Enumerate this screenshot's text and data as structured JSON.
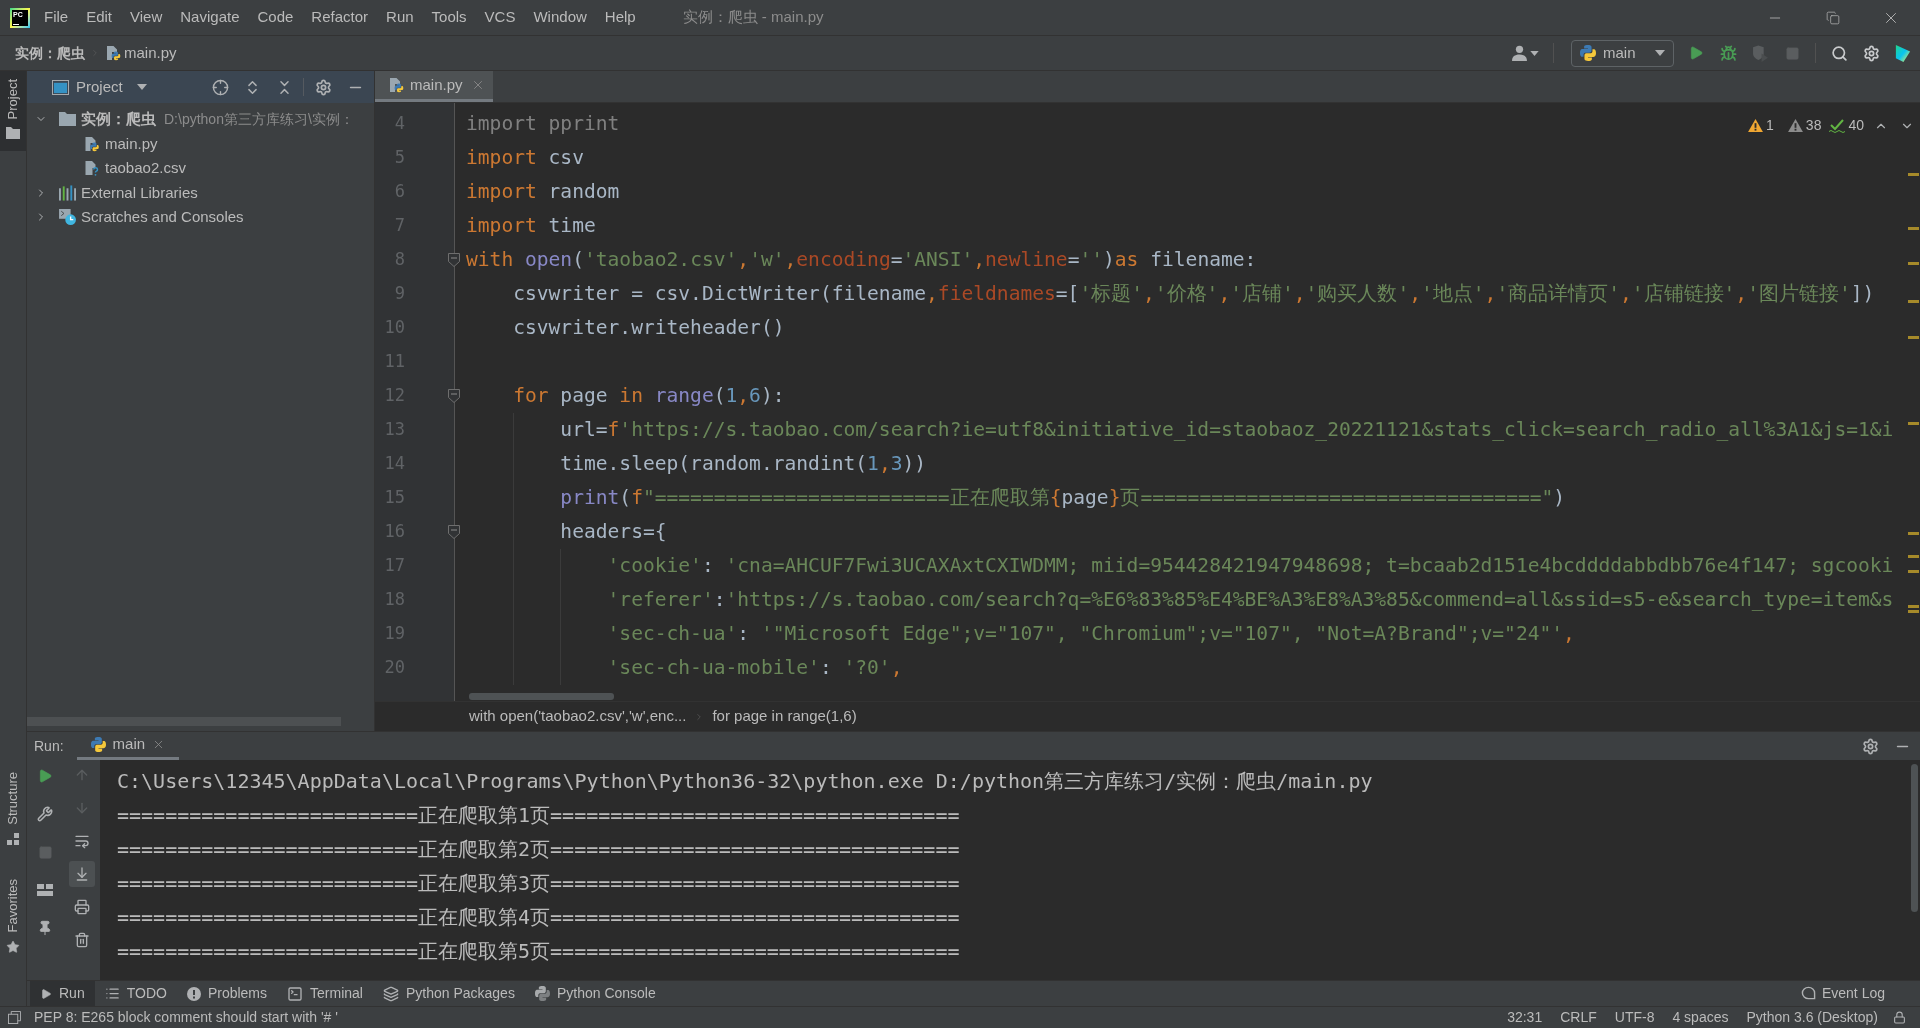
{
  "menu_bar": {
    "logo": "PC",
    "items": [
      "File",
      "Edit",
      "View",
      "Navigate",
      "Code",
      "Refactor",
      "Run",
      "Tools",
      "VCS",
      "Window",
      "Help"
    ],
    "window_title": "实例：爬虫 - main.py"
  },
  "nav_bar": {
    "project": "实例：爬虫",
    "file": "main.py",
    "run_config": "main",
    "actions": [
      {
        "kind": "run",
        "disabled": false
      },
      {
        "kind": "debug",
        "disabled": false
      },
      {
        "kind": "coverage",
        "disabled": true
      },
      {
        "kind": "stop",
        "disabled": true
      }
    ]
  },
  "left_stripe": {
    "top": [
      {
        "kind": "project",
        "label": "Project",
        "selected": true
      }
    ],
    "bottom": [
      {
        "kind": "structure",
        "label": "Structure",
        "selected": false
      },
      {
        "kind": "favorites",
        "label": "Favorites",
        "selected": false
      }
    ]
  },
  "project_panel": {
    "title": "Project",
    "tree": [
      {
        "kind": "folder",
        "label": "实例：爬虫",
        "path": "D:\\python第三方库练习\\实例：",
        "expanded": true,
        "children": [
          {
            "kind": "python",
            "label": "main.py"
          },
          {
            "kind": "unknown",
            "label": "taobao2.csv"
          }
        ]
      },
      {
        "kind": "libraries",
        "label": "External Libraries",
        "expanded": false
      },
      {
        "kind": "scratches",
        "label": "Scratches and Consoles",
        "expanded": false
      }
    ]
  },
  "editor": {
    "tabs": [
      {
        "label": "main.py",
        "selected": true
      }
    ],
    "inspections": {
      "warnings": "1",
      "weak_warnings": "38",
      "typos": "40"
    },
    "lines": [
      {
        "number": "4",
        "tokens": [
          {
            "kind": "unused",
            "text": "import pprint"
          }
        ]
      },
      {
        "number": "5",
        "tokens": [
          {
            "kind": "keyword",
            "text": "import"
          },
          {
            "kind": "plain",
            "text": " csv"
          }
        ]
      },
      {
        "number": "6",
        "tokens": [
          {
            "kind": "keyword",
            "text": "import"
          },
          {
            "kind": "plain",
            "text": " random"
          }
        ]
      },
      {
        "number": "7",
        "tokens": [
          {
            "kind": "keyword",
            "text": "import"
          },
          {
            "kind": "plain",
            "text": " time"
          }
        ]
      },
      {
        "number": "8",
        "tokens": [
          {
            "kind": "keyword",
            "text": "with"
          },
          {
            "kind": "builtin",
            "text": " open"
          },
          {
            "kind": "plain",
            "text": "("
          },
          {
            "kind": "string",
            "text": "'taobao2.csv'"
          },
          {
            "kind": "comma",
            "text": ","
          },
          {
            "kind": "string",
            "text": "'w'"
          },
          {
            "kind": "comma",
            "text": ","
          },
          {
            "kind": "param",
            "text": "encoding"
          },
          {
            "kind": "plain",
            "text": "="
          },
          {
            "kind": "string",
            "text": "'ANSI'"
          },
          {
            "kind": "comma",
            "text": ","
          },
          {
            "kind": "param",
            "text": "newline"
          },
          {
            "kind": "plain",
            "text": "="
          },
          {
            "kind": "string",
            "text": "''"
          },
          {
            "kind": "plain",
            "text": ")"
          },
          {
            "kind": "keyword",
            "text": "as"
          },
          {
            "kind": "plain",
            "text": " filename:"
          }
        ],
        "children": [
          {
            "number": "9",
            "tokens": [
              {
                "kind": "plain",
                "text": "csvwriter = csv.DictWriter(filename"
              },
              {
                "kind": "comma",
                "text": ","
              },
              {
                "kind": "param",
                "text": "fieldnames"
              },
              {
                "kind": "plain",
                "text": "=["
              },
              {
                "kind": "string",
                "text": "'标题'"
              },
              {
                "kind": "comma",
                "text": ","
              },
              {
                "kind": "string",
                "text": "'价格'"
              },
              {
                "kind": "comma",
                "text": ","
              },
              {
                "kind": "string",
                "text": "'店铺'"
              },
              {
                "kind": "comma",
                "text": ","
              },
              {
                "kind": "string",
                "text": "'购买人数'"
              },
              {
                "kind": "comma",
                "text": ","
              },
              {
                "kind": "string",
                "text": "'地点'"
              },
              {
                "kind": "comma",
                "text": ","
              },
              {
                "kind": "string",
                "text": "'商品详情页'"
              },
              {
                "kind": "comma",
                "text": ","
              },
              {
                "kind": "string",
                "text": "'店铺链接'"
              },
              {
                "kind": "comma",
                "text": ","
              },
              {
                "kind": "string",
                "text": "'图片链接'"
              },
              {
                "kind": "plain",
                "text": "])"
              }
            ]
          },
          {
            "number": "10",
            "tokens": [
              {
                "kind": "plain",
                "text": "csvwriter.writeheader()"
              }
            ]
          },
          {
            "number": "11"
          },
          {
            "number": "12",
            "tokens": [
              {
                "kind": "keyword",
                "text": "for"
              },
              {
                "kind": "plain",
                "text": " page "
              },
              {
                "kind": "keyword",
                "text": "in"
              },
              {
                "kind": "builtin",
                "text": " range"
              },
              {
                "kind": "plain",
                "text": "("
              },
              {
                "kind": "number",
                "text": "1"
              },
              {
                "kind": "comma",
                "text": ","
              },
              {
                "kind": "number",
                "text": "6"
              },
              {
                "kind": "plain",
                "text": "):"
              }
            ],
            "children": [
              {
                "number": "13",
                "tokens": [
                  {
                    "kind": "plain",
                    "text": "url="
                  },
                  {
                    "kind": "keyword",
                    "text": "f"
                  },
                  {
                    "kind": "string",
                    "text": "'https://s.taobao.com/search?ie=utf8&initiative_id=staobaoz_20221121&stats_click=search_radio_all%3A1&js=1&i"
                  }
                ]
              },
              {
                "number": "14",
                "tokens": [
                  {
                    "kind": "plain",
                    "text": "time.sleep(random.randint("
                  },
                  {
                    "kind": "number",
                    "text": "1"
                  },
                  {
                    "kind": "comma",
                    "text": ","
                  },
                  {
                    "kind": "number",
                    "text": "3"
                  },
                  {
                    "kind": "plain",
                    "text": "))"
                  }
                ]
              },
              {
                "number": "15",
                "tokens": [
                  {
                    "kind": "builtin",
                    "text": "print"
                  },
                  {
                    "kind": "plain",
                    "text": "("
                  },
                  {
                    "kind": "keyword",
                    "text": "f"
                  },
                  {
                    "kind": "string",
                    "text": "\"=========================正在爬取第"
                  },
                  {
                    "kind": "brace",
                    "text": "{"
                  },
                  {
                    "kind": "plain",
                    "text": "page"
                  },
                  {
                    "kind": "brace",
                    "text": "}"
                  },
                  {
                    "kind": "string",
                    "text": "页==================================\""
                  },
                  {
                    "kind": "plain",
                    "text": ")"
                  }
                ]
              },
              {
                "number": "16",
                "tokens": [
                  {
                    "kind": "plain",
                    "text": "headers={"
                  }
                ],
                "children": [
                  {
                    "number": "17",
                    "tokens": [
                      {
                        "kind": "string",
                        "text": "'cookie'"
                      },
                      {
                        "kind": "plain",
                        "text": ": "
                      },
                      {
                        "kind": "string",
                        "text": "'cna=AHCUF7Fwi3UCAXAxtCXIWDMM; miid=954428421947948698; t=bcaab2d151e4bcddddabbdbb76e4f147; sgcooki"
                      }
                    ]
                  },
                  {
                    "number": "18",
                    "tokens": [
                      {
                        "kind": "string",
                        "text": "'referer'"
                      },
                      {
                        "kind": "plain",
                        "text": ":"
                      },
                      {
                        "kind": "string",
                        "text": "'https://s.taobao.com/search?q=%E6%83%85%E4%BE%A3%E8%A3%85&commend=all&ssid=s5-e&search_type=item&s"
                      }
                    ]
                  },
                  {
                    "number": "19",
                    "tokens": [
                      {
                        "kind": "string",
                        "text": "'sec-ch-ua'"
                      },
                      {
                        "kind": "plain",
                        "text": ": "
                      },
                      {
                        "kind": "string",
                        "text": "'\"Microsoft Edge\";v=\"107\", \"Chromium\";v=\"107\", \"Not=A?Brand\";v=\"24\"'"
                      },
                      {
                        "kind": "comma",
                        "text": ","
                      }
                    ]
                  },
                  {
                    "number": "20",
                    "tokens": [
                      {
                        "kind": "string",
                        "text": "'sec-ch-ua-mobile'"
                      },
                      {
                        "kind": "plain",
                        "text": ": "
                      },
                      {
                        "kind": "string",
                        "text": "'?0'"
                      },
                      {
                        "kind": "comma",
                        "text": ","
                      }
                    ]
                  }
                ]
              }
            ]
          }
        ]
      }
    ],
    "breadcrumbs": [
      "with open('taobao2.csv','w',enc...",
      "for page in range(1,6)"
    ]
  },
  "run_panel": {
    "title": "Run:",
    "tabs": [
      {
        "label": "main",
        "selected": true
      }
    ],
    "left_actions": [
      {
        "kind": "rerun",
        "disabled": false
      },
      {
        "kind": "modify",
        "disabled": false
      },
      {
        "kind": "stop",
        "disabled": true
      },
      {
        "kind": "layout",
        "disabled": false
      },
      {
        "kind": "pin",
        "disabled": false
      }
    ],
    "right_actions": [
      {
        "kind": "up",
        "disabled": true,
        "on": false
      },
      {
        "kind": "down",
        "disabled": true,
        "on": false
      },
      {
        "kind": "wrap",
        "disabled": false,
        "on": false
      },
      {
        "kind": "autoscroll",
        "disabled": false,
        "on": true
      },
      {
        "kind": "print",
        "disabled": false,
        "on": false
      },
      {
        "kind": "clear",
        "disabled": false,
        "on": false
      }
    ],
    "output": [
      "C:\\Users\\12345\\AppData\\Local\\Programs\\Python\\Python36-32\\python.exe D:/python第三方库练习/实例：爬虫/main.py",
      "=========================正在爬取第1页==================================",
      "=========================正在爬取第2页==================================",
      "=========================正在爬取第3页==================================",
      "=========================正在爬取第4页==================================",
      "=========================正在爬取第5页=================================="
    ]
  },
  "tool_window_bar": {
    "items": [
      {
        "kind": "run",
        "label": "Run",
        "selected": true
      },
      {
        "kind": "todo",
        "label": "TODO",
        "selected": false
      },
      {
        "kind": "problems",
        "label": "Problems",
        "selected": false
      },
      {
        "kind": "terminal",
        "label": "Terminal",
        "selected": false
      },
      {
        "kind": "packages",
        "label": "Python Packages",
        "selected": false
      },
      {
        "kind": "console",
        "label": "Python Console",
        "selected": false
      }
    ],
    "event_log": "Event Log"
  },
  "status_bar": {
    "message": "PEP 8: E265 block comment should start with '# '",
    "items": [
      "32:31",
      "CRLF",
      "UTF-8",
      "4 spaces",
      "Python 3.6 (Desktop)"
    ]
  }
}
